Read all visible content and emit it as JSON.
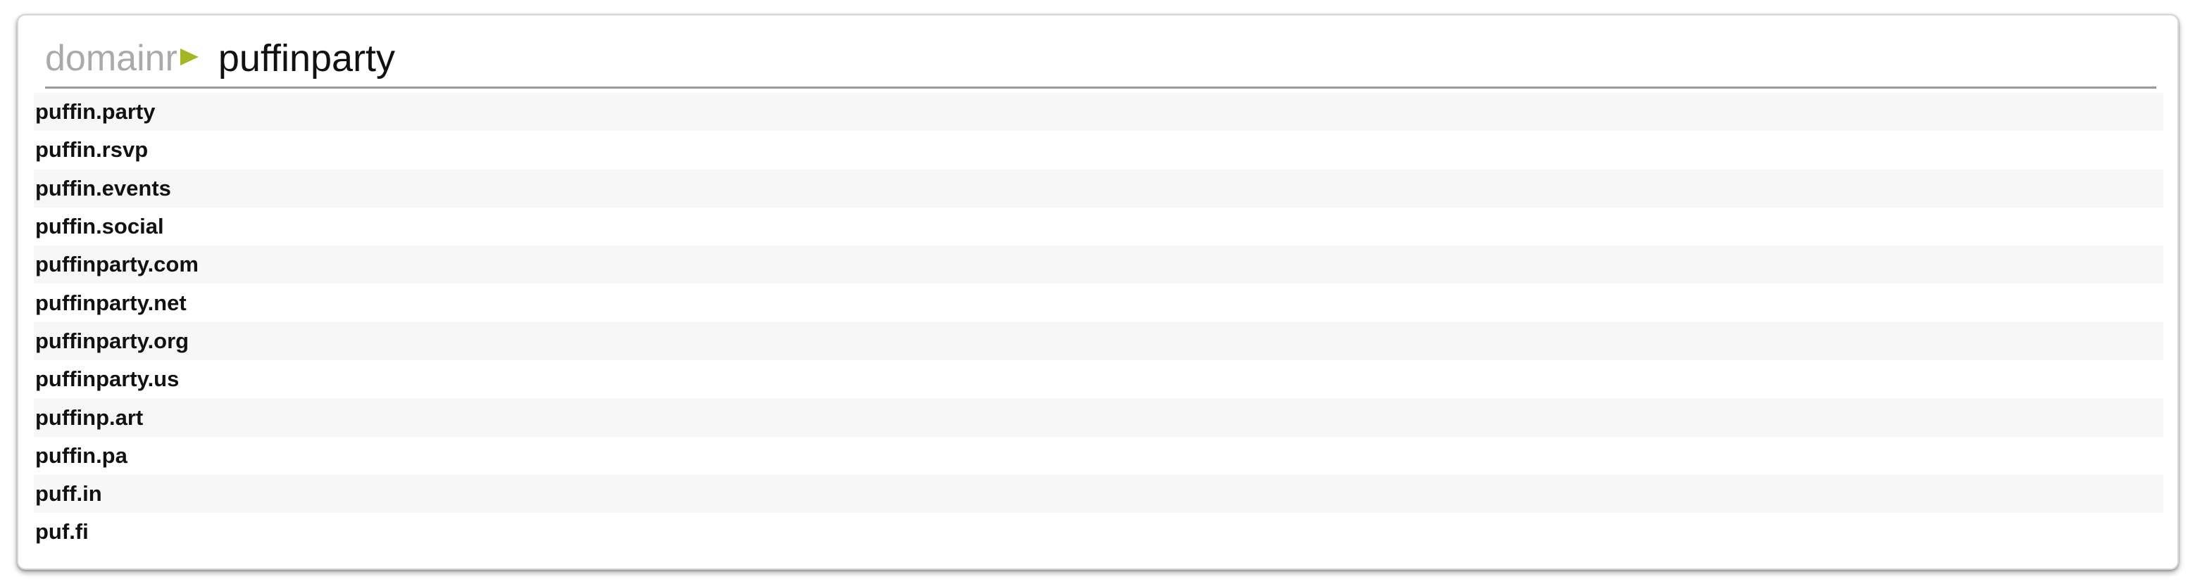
{
  "search": {
    "logo_text": "domainr",
    "query": "puffinparty"
  },
  "colors": {
    "logo_text": "#aaaaaa",
    "logo_arrow": "#a6b522",
    "row_stripe": "#f7f7f7"
  },
  "results": [
    {
      "domain": "puffin.party"
    },
    {
      "domain": "puffin.rsvp"
    },
    {
      "domain": "puffin.events"
    },
    {
      "domain": "puffin.social"
    },
    {
      "domain": "puffinparty.com"
    },
    {
      "domain": "puffinparty.net"
    },
    {
      "domain": "puffinparty.org"
    },
    {
      "domain": "puffinparty.us"
    },
    {
      "domain": "puffinp.art"
    },
    {
      "domain": "puffin.pa"
    },
    {
      "domain": "puff.in"
    },
    {
      "domain": "puf.fi"
    }
  ]
}
